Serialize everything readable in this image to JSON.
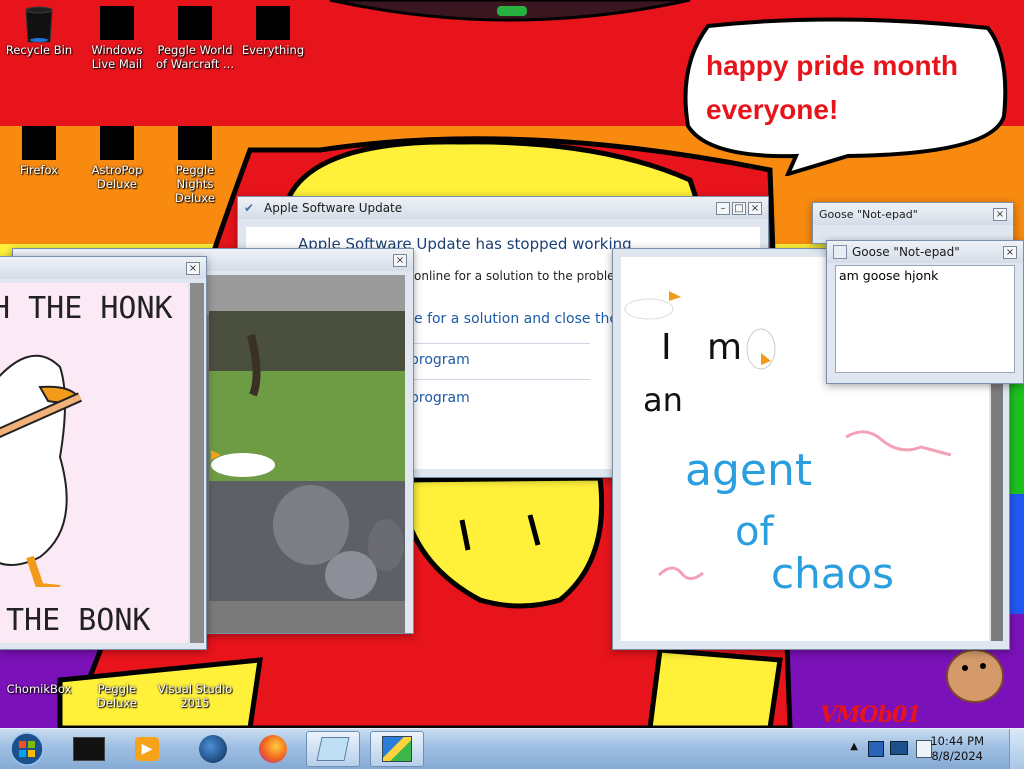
{
  "desktop_icons": [
    {
      "id": "recycle-bin",
      "label": "Recycle Bin"
    },
    {
      "id": "windows-live-mail",
      "label": "Windows Live Mail"
    },
    {
      "id": "peggle-world-of-warcraft",
      "label": "Peggle World of Warcraft ..."
    },
    {
      "id": "everything",
      "label": "Everything"
    },
    {
      "id": "firefox",
      "label": "Firefox"
    },
    {
      "id": "astropop-deluxe",
      "label": "AstroPop Deluxe"
    },
    {
      "id": "peggle-nights-deluxe",
      "label": "Peggle Nights Deluxe"
    },
    {
      "id": "chomikbox",
      "label": "ChomikBox"
    },
    {
      "id": "peggle-deluxe",
      "label": "Peggle Deluxe"
    },
    {
      "id": "visual-studio-2015",
      "label": "Visual Studio 2015"
    }
  ],
  "bubble": {
    "line1": "happy pride month",
    "line2": "everyone!"
  },
  "apple_update": {
    "title": "Apple Software Update",
    "heading": "Apple Software Update has stopped working",
    "body1": "online for a solution to the problem.",
    "option1": "e for a solution and close the",
    "option2": "program",
    "option3": "program"
  },
  "honk_window": {
    "top_text": "H THE HONK",
    "bottom_text": "THE BONK"
  },
  "paint_window": {
    "words": [
      "I",
      "m",
      "an",
      "agent",
      "of",
      "chaos"
    ]
  },
  "notepad_back": {
    "title": "Goose \"Not-epad\""
  },
  "notepad_front": {
    "title": "Goose \"Not-epad\"",
    "content": "am goose hjonk"
  },
  "watermark": "VMOb01",
  "clock": {
    "time": "10:44 PM",
    "date": "8/8/2024"
  },
  "taskbar_items": [
    {
      "id": "start",
      "icon": "windows-orb-icon"
    },
    {
      "id": "cmd",
      "icon": "terminal-icon"
    },
    {
      "id": "media",
      "icon": "media-player-icon"
    },
    {
      "id": "globe",
      "icon": "globe-icon"
    },
    {
      "id": "firefox",
      "icon": "firefox-icon"
    },
    {
      "id": "notepad",
      "icon": "notepad-icon"
    },
    {
      "id": "paint",
      "icon": "paint-icon"
    }
  ],
  "colors": {
    "red": "#e8141b",
    "orange": "#f98a10",
    "yellow": "#fff13a",
    "green": "#1ec020",
    "blue": "#2157f5",
    "purple": "#7b11b8",
    "bubble_text": "#e8141b",
    "link": "#1c5aa8"
  }
}
